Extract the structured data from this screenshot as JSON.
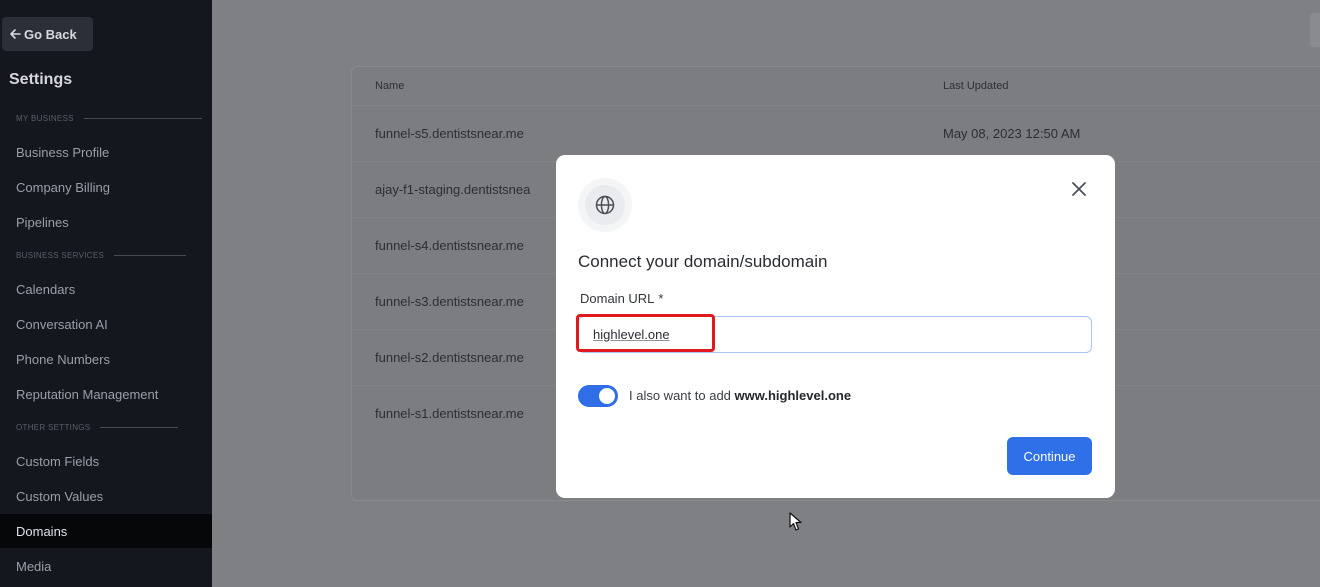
{
  "sidebar": {
    "go_back": "Go Back",
    "title": "Settings",
    "sections": {
      "my_business": "MY BUSINESS",
      "business_services": "BUSINESS SERVICES",
      "other_settings": "OTHER SETTINGS"
    },
    "items": {
      "business_profile": "Business Profile",
      "company_billing": "Company Billing",
      "pipelines": "Pipelines",
      "calendars": "Calendars",
      "conversation_ai": "Conversation AI",
      "phone_numbers": "Phone Numbers",
      "reputation_management": "Reputation Management",
      "custom_fields": "Custom Fields",
      "custom_values": "Custom Values",
      "domains": "Domains",
      "media": "Media"
    },
    "active_item": "Domains"
  },
  "table": {
    "columns": [
      "Name",
      "Last Updated"
    ],
    "rows": [
      {
        "name": "funnel-s5.dentistsnear.me",
        "updated": "May 08, 2023 12:50 AM"
      },
      {
        "name": "ajay-f1-staging.dentistsnea",
        "updated": ""
      },
      {
        "name": "funnel-s4.dentistsnear.me",
        "updated": ""
      },
      {
        "name": "funnel-s3.dentistsnear.me",
        "updated": ""
      },
      {
        "name": "funnel-s2.dentistsnear.me",
        "updated": ""
      },
      {
        "name": "funnel-s1.dentistsnear.me",
        "updated": ""
      }
    ]
  },
  "modal": {
    "title": "Connect your domain/subdomain",
    "field_label": "Domain URL",
    "required_mark": "*",
    "domain_value": "highlevel.one",
    "toggle_on": true,
    "toggle_text": "I also want to add",
    "toggle_domain": "www.highlevel.one",
    "continue_label": "Continue"
  },
  "colors": {
    "sidebar_bg": "#14171e",
    "accent_blue": "#2f6fe8",
    "highlight_red": "#e0191f",
    "overlay_gray": "#7f8083"
  },
  "icons": [
    "arrow-left-icon",
    "globe-icon",
    "close-icon",
    "mouse-cursor-icon",
    "text-cursor-icon"
  ]
}
